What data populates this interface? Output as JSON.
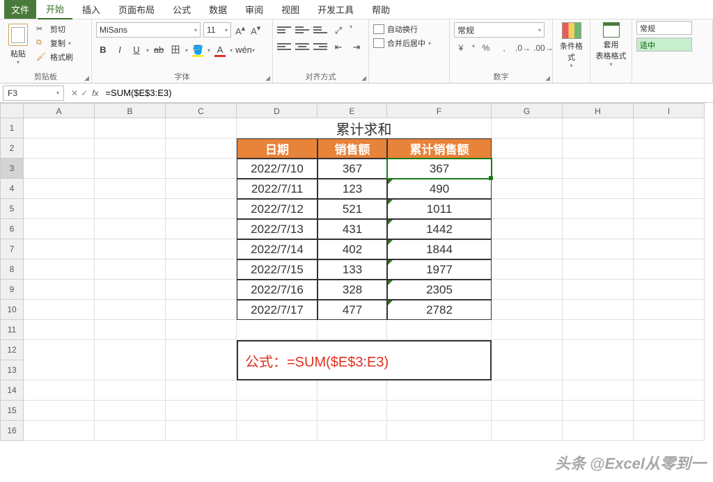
{
  "menu": {
    "file": "文件",
    "tabs": [
      "开始",
      "插入",
      "页面布局",
      "公式",
      "数据",
      "审阅",
      "视图",
      "开发工具",
      "帮助"
    ],
    "active_index": 0
  },
  "ribbon": {
    "clipboard": {
      "paste": "粘贴",
      "cut": "剪切",
      "copy": "复制",
      "format_painter": "格式刷",
      "group_label": "剪贴板"
    },
    "font": {
      "font_name": "MiSans",
      "font_size": "11",
      "btns": {
        "bold": "B",
        "italic": "I",
        "underline": "U",
        "strike": "ab",
        "border": "田"
      },
      "group_label": "字体"
    },
    "alignment": {
      "wrap_text": "自动换行",
      "merge_center": "合并后居中",
      "group_label": "对齐方式"
    },
    "number": {
      "format": "常规",
      "group_label": "数字"
    },
    "cond_format": "条件格式",
    "table_style": "套用\n表格格式",
    "styles": {
      "normal": "常规",
      "good": "适中"
    }
  },
  "formula_bar": {
    "cell_ref": "F3",
    "formula": "=SUM($E$3:E3)"
  },
  "grid": {
    "columns": [
      "A",
      "B",
      "C",
      "D",
      "E",
      "F",
      "G",
      "H",
      "I"
    ],
    "rows": [
      "1",
      "2",
      "3",
      "4",
      "5",
      "6",
      "7",
      "8",
      "9",
      "10",
      "11",
      "12",
      "13",
      "14",
      "15",
      "16"
    ],
    "selected_row": 3
  },
  "sheet": {
    "title": "累计求和",
    "headers": {
      "date": "日期",
      "sales": "销售额",
      "cum_sales": "累计销售额"
    },
    "data": [
      {
        "date": "2022/7/10",
        "sales": "367",
        "cum": "367"
      },
      {
        "date": "2022/7/11",
        "sales": "123",
        "cum": "490"
      },
      {
        "date": "2022/7/12",
        "sales": "521",
        "cum": "1011"
      },
      {
        "date": "2022/7/13",
        "sales": "431",
        "cum": "1442"
      },
      {
        "date": "2022/7/14",
        "sales": "402",
        "cum": "1844"
      },
      {
        "date": "2022/7/15",
        "sales": "133",
        "cum": "1977"
      },
      {
        "date": "2022/7/16",
        "sales": "328",
        "cum": "2305"
      },
      {
        "date": "2022/7/17",
        "sales": "477",
        "cum": "2782"
      }
    ],
    "formula_display": "公式：=SUM($E$3:E3)"
  },
  "watermark": "头条 @Excel从零到一"
}
